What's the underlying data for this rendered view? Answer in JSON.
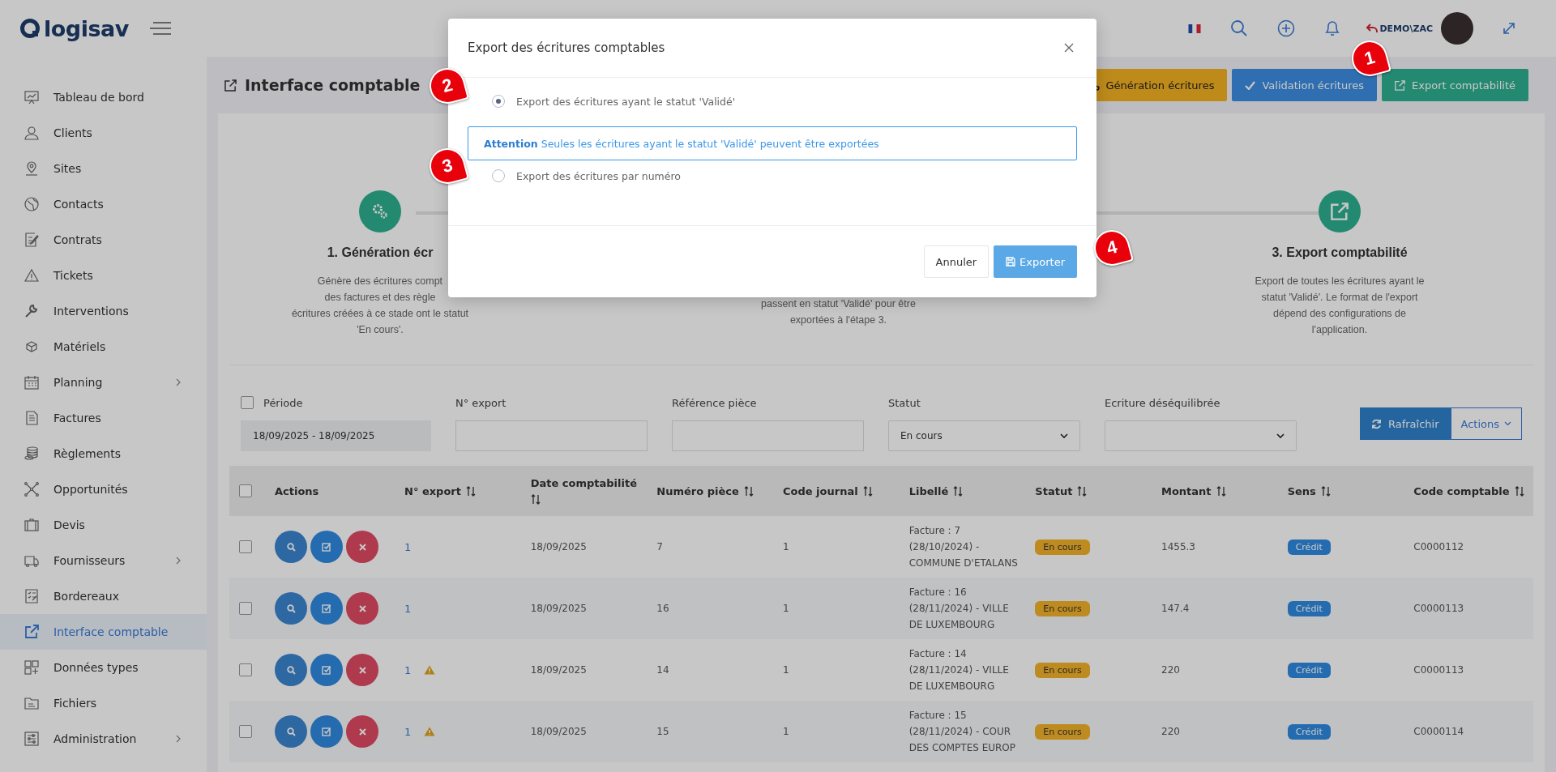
{
  "topbar": {
    "logo": "logisav",
    "user": "DEMO\\ZAC"
  },
  "sidebar": {
    "items": [
      {
        "label": "Tableau de bord",
        "has_children": false,
        "selected": false
      },
      {
        "label": "Clients",
        "has_children": false,
        "selected": false
      },
      {
        "label": "Sites",
        "has_children": false,
        "selected": false
      },
      {
        "label": "Contacts",
        "has_children": false,
        "selected": false
      },
      {
        "label": "Contrats",
        "has_children": false,
        "selected": false
      },
      {
        "label": "Tickets",
        "has_children": false,
        "selected": false
      },
      {
        "label": "Interventions",
        "has_children": false,
        "selected": false
      },
      {
        "label": "Matériels",
        "has_children": false,
        "selected": false
      },
      {
        "label": "Planning",
        "has_children": true,
        "selected": false
      },
      {
        "label": "Factures",
        "has_children": false,
        "selected": false
      },
      {
        "label": "Règlements",
        "has_children": false,
        "selected": false
      },
      {
        "label": "Opportunités",
        "has_children": false,
        "selected": false
      },
      {
        "label": "Devis",
        "has_children": false,
        "selected": false
      },
      {
        "label": "Fournisseurs",
        "has_children": true,
        "selected": false
      },
      {
        "label": "Bordereaux",
        "has_children": false,
        "selected": false
      },
      {
        "label": "Interface comptable",
        "has_children": false,
        "selected": true
      },
      {
        "label": "Données types",
        "has_children": false,
        "selected": false
      },
      {
        "label": "Fichiers",
        "has_children": false,
        "selected": false
      },
      {
        "label": "Administration",
        "has_children": true,
        "selected": false
      }
    ]
  },
  "page": {
    "title": "Interface comptable",
    "buttons": [
      {
        "label": "Génération écritures",
        "kind": "generate"
      },
      {
        "label": "Validation écritures",
        "kind": "validate"
      },
      {
        "label": "Export comptabilité",
        "kind": "export"
      }
    ]
  },
  "steps": [
    {
      "kind": "generate",
      "title": "1. Génération écr",
      "description": "Génère des écritures compt\ndes factures et des règle\nécritures créées à ce stade ont le statut\n'En cours'."
    },
    {
      "kind": "hidden",
      "description": "passent en statut 'Validé' pour être\nexportées à l'étape 3."
    },
    {
      "kind": "export",
      "title": "3. Export comptabilité",
      "description": "Export de toutes les écritures ayant le\nstatut 'Validé'. Le format de l'export\ndépend des configurations de\nl'application."
    }
  ],
  "filters": {
    "period": {
      "label": "Période",
      "checked": false,
      "value": "18/09/2025 - 18/09/2025"
    },
    "export_number": {
      "label": "N° export"
    },
    "piece_reference": {
      "label": "Référence pièce"
    },
    "status": {
      "label": "Statut",
      "value": "En cours"
    },
    "unbalanced": {
      "label": "Ecriture déséquilibrée"
    },
    "refresh_button": "Rafraîchir",
    "actions_button": "Actions"
  },
  "table": {
    "select_all_checked": false,
    "actions_column": "Actions",
    "columns": [
      "N° export",
      "Date comptabilité",
      "Numéro pièce",
      "Code journal",
      "Libellé",
      "Statut",
      "Montant",
      "Sens",
      "Code comptable"
    ],
    "rows": [
      {
        "checked": false,
        "export": "1",
        "warning": false,
        "date": "18/09/2025",
        "piece": "7",
        "journal": "1",
        "label": "Facture : 7 (28/10/2024) - COMMUNE D'ETALANS",
        "status": "En cours",
        "amount": "1455.3",
        "direction": "Crédit",
        "account": "C0000112"
      },
      {
        "checked": false,
        "export": "1",
        "warning": false,
        "date": "18/09/2025",
        "piece": "16",
        "journal": "1",
        "label": "Facture : 16 (28/11/2024) - VILLE DE LUXEMBOURG",
        "status": "En cours",
        "amount": "147.4",
        "direction": "Crédit",
        "account": "C0000113"
      },
      {
        "checked": false,
        "export": "1",
        "warning": true,
        "date": "18/09/2025",
        "piece": "14",
        "journal": "1",
        "label": "Facture : 14 (28/11/2024) - VILLE DE LUXEMBOURG",
        "status": "En cours",
        "amount": "220",
        "direction": "Crédit",
        "account": "C0000113"
      },
      {
        "checked": false,
        "export": "1",
        "warning": true,
        "date": "18/09/2025",
        "piece": "15",
        "journal": "1",
        "label": "Facture : 15 (28/11/2024) - COUR DES COMPTES EUROP",
        "status": "En cours",
        "amount": "220",
        "direction": "Crédit",
        "account": "C0000114"
      }
    ]
  },
  "modal": {
    "title": "Export des écritures comptables",
    "options": [
      {
        "label": "Export des écritures ayant le statut 'Validé'",
        "selected": true
      },
      {
        "label": "Export des écritures par numéro",
        "selected": false
      }
    ],
    "alert": "**Attention** Seules les écritures ayant le statut 'Validé' peuvent être exportées",
    "cancel": "Annuler",
    "submit": "Exporter"
  },
  "callouts": [
    {
      "number": "1"
    },
    {
      "number": "2"
    },
    {
      "number": "3"
    },
    {
      "number": "4"
    }
  ]
}
